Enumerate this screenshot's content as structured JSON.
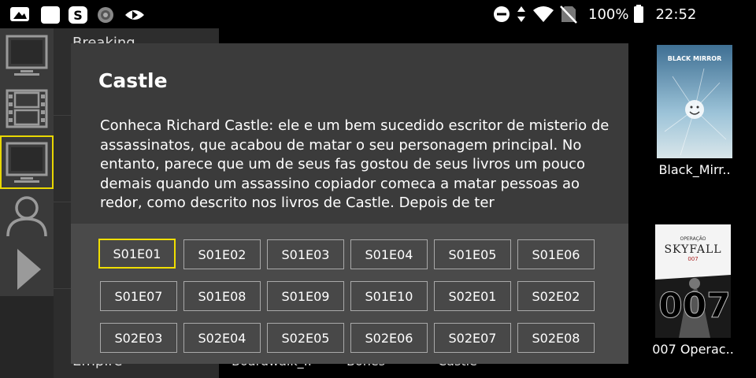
{
  "status_bar": {
    "battery": "100%",
    "time": "22:52",
    "left_icons": [
      "gallery-icon",
      "square-app-icon",
      "skype-icon",
      "radio-icon",
      "play-app-icon"
    ],
    "right_icons": [
      "do-not-disturb-icon",
      "data-arrows-icon",
      "wifi-icon",
      "no-sim-icon",
      "battery-icon"
    ]
  },
  "rail": {
    "items": [
      {
        "name": "tv-icon"
      },
      {
        "name": "film-icon"
      },
      {
        "name": "tv-series-icon"
      },
      {
        "name": "user-icon"
      },
      {
        "name": "play-arrow-icon"
      }
    ]
  },
  "background": {
    "top_partial": "Breaking",
    "bottom_left": "Empire",
    "bottom_items": [
      "Boardwalk_..",
      "Bones",
      "Castle"
    ]
  },
  "posters": [
    {
      "label": "Black_Mirr..",
      "art_text": "BLACK MIRROR"
    },
    {
      "label": "007 Operac..",
      "art_top": "OPERAÇÃO",
      "art_title": "SKYFALL",
      "art_num": "007"
    }
  ],
  "dialog": {
    "title": "Castle",
    "description": "Conheca Richard Castle: ele e um bem sucedido escritor de misterio de assassinatos, que acabou de matar o seu personagem principal. No entanto, parece que um de seus fas gostou de seus livros um pouco demais quando um assassino copiador comeca a matar pessoas ao redor, como descrito nos livros de Castle. Depois de ter",
    "episodes": [
      "S01E01",
      "S01E02",
      "S01E03",
      "S01E04",
      "S01E05",
      "S01E06",
      "S01E07",
      "S01E08",
      "S01E09",
      "S01E10",
      "S02E01",
      "S02E02",
      "S02E03",
      "S02E04",
      "S02E05",
      "S02E06",
      "S02E07",
      "S02E08"
    ],
    "focused_episode": "S01E01"
  },
  "colors": {
    "focus": "#f0df00",
    "dialog_bg": "#3b3b3b",
    "episodes_bg": "#4a4a4a"
  }
}
